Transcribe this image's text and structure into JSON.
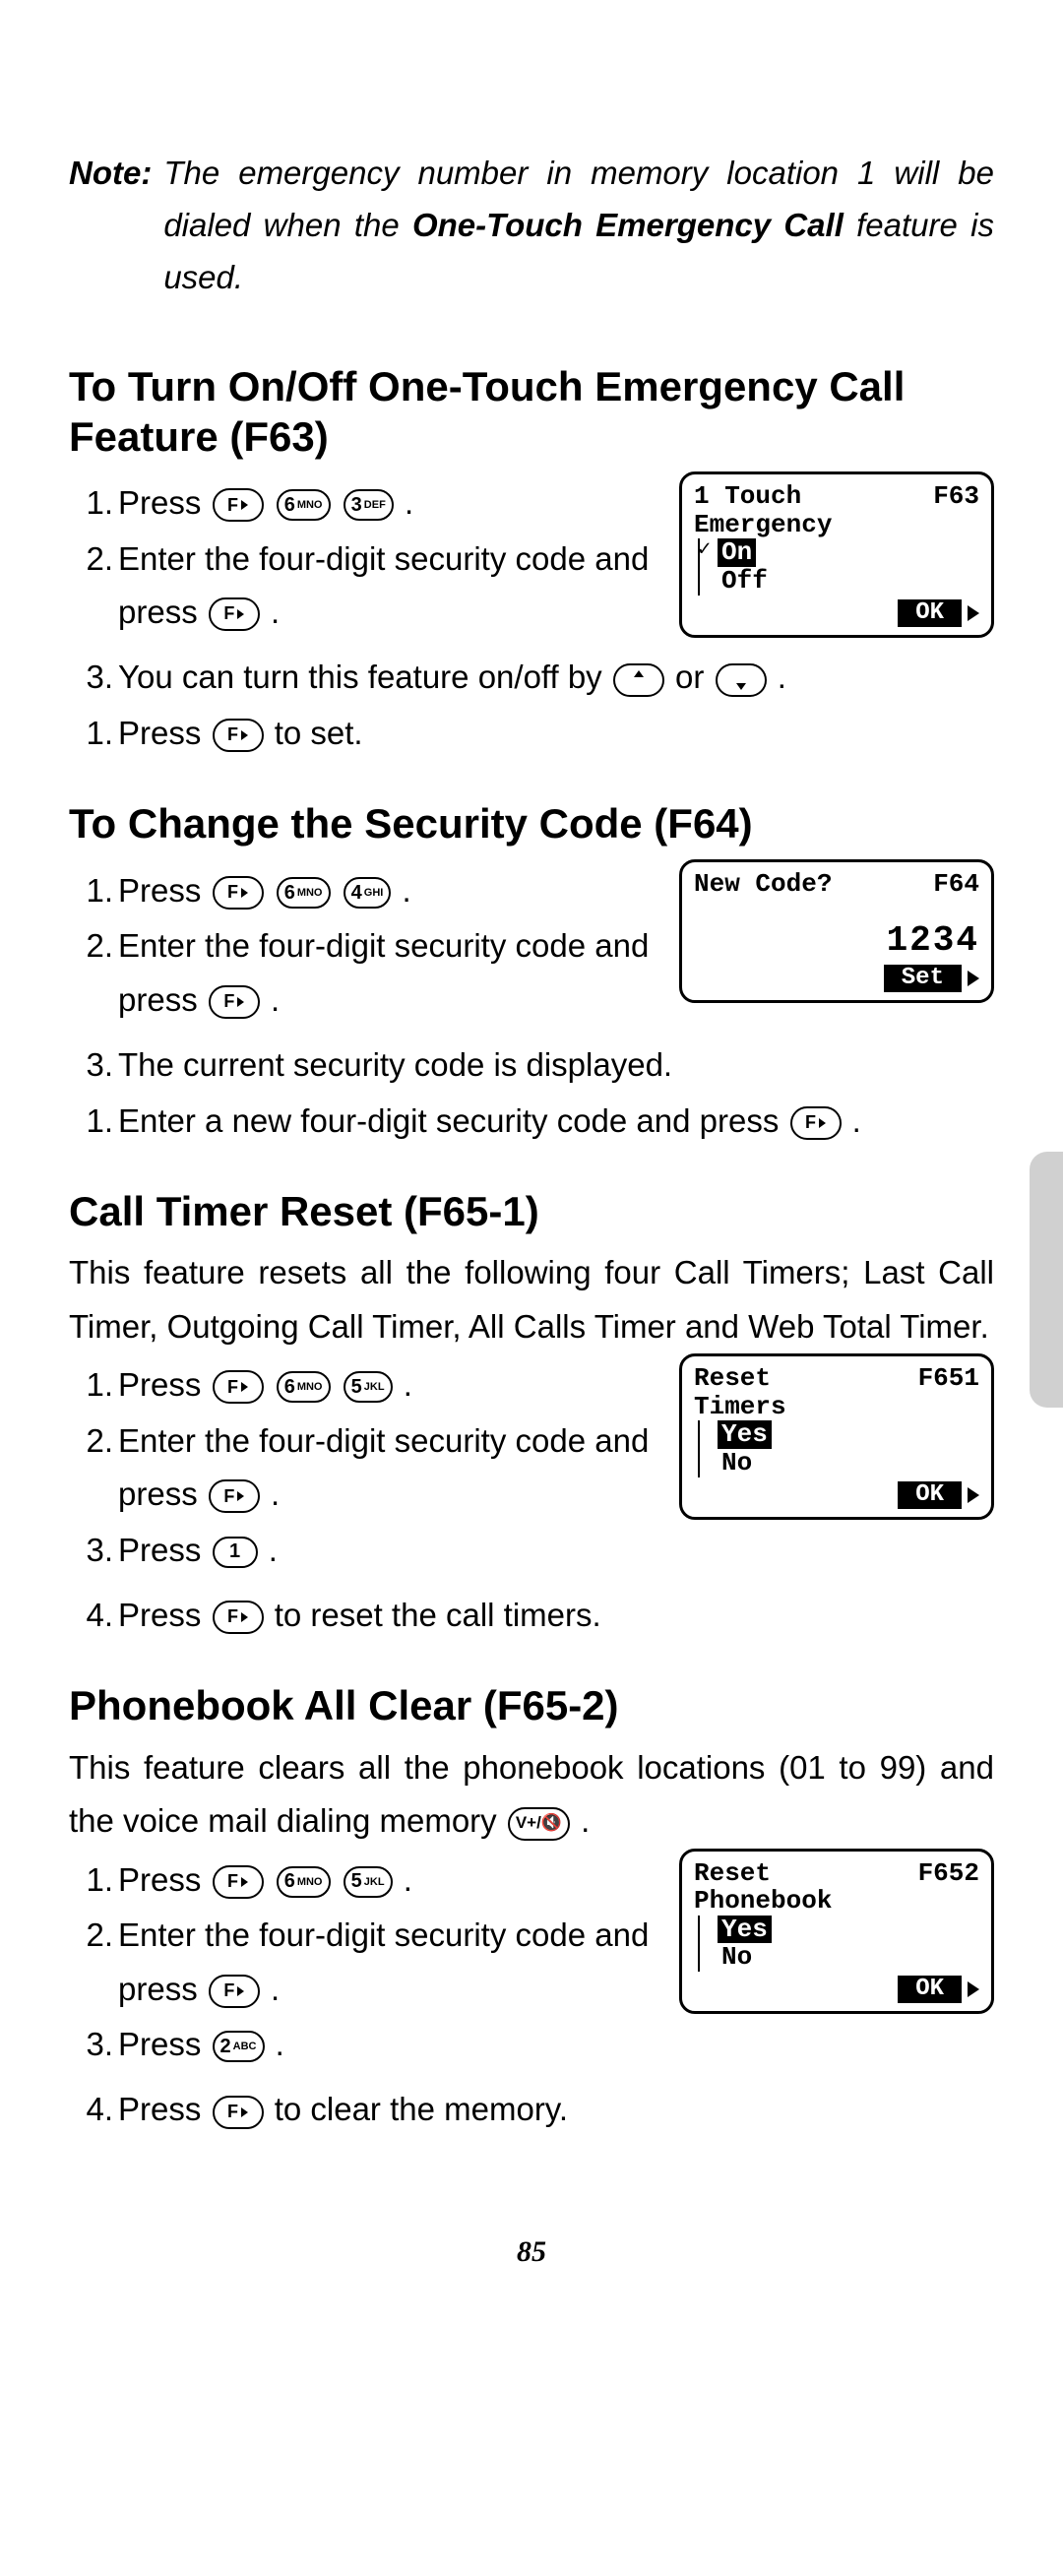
{
  "note": {
    "label": "Note:",
    "text_before": "The emergency number in memory location 1 will be dialed when the ",
    "bold": "One-Touch Emergency Call",
    "text_after": " feature is used."
  },
  "sections": {
    "f63": {
      "heading": "To Turn On/Off One-Touch Emergency Call Feature (F63)",
      "step1": "Press ",
      "step2a": "Enter the four-digit security code and press ",
      "step3a": "You can turn this feature on/off by ",
      "step3b": " or ",
      "step4a": "Press ",
      "step4b": " to set.",
      "screen": {
        "line1_left": "1 Touch",
        "line1_right": "F63",
        "line2": "Emergency",
        "opt_on": "On",
        "opt_off": "Off",
        "ok": "OK"
      }
    },
    "f64": {
      "heading": "To Change the Security Code (F64)",
      "step1": "Press ",
      "step2a": "Enter the four-digit security code and press ",
      "step3": "The current security code is displayed.",
      "step4a": "Enter a new four-digit security code and press ",
      "screen": {
        "line1_left": "New Code?",
        "line1_right": "F64",
        "value": "1234",
        "set": "Set"
      }
    },
    "f651": {
      "heading": "Call Timer Reset (F65-1)",
      "intro": "This feature resets all the following four Call Timers; Last Call Timer, Outgoing Call Timer, All Calls Timer and Web Total Timer.",
      "step1": "Press ",
      "step2a": "Enter the four-digit security code and press ",
      "step3": "Press ",
      "step4a": "Press ",
      "step4b": " to reset the call timers.",
      "screen": {
        "line1_left": "Reset",
        "line1_right": "F651",
        "line2": "Timers",
        "yes": "Yes",
        "no": "No",
        "ok": "OK"
      }
    },
    "f652": {
      "heading": "Phonebook All Clear (F65-2)",
      "intro_a": "This feature clears all the phonebook locations (01 to 99) and the voice mail dialing memory ",
      "step1": "Press ",
      "step2a": "Enter the four-digit security code and press ",
      "step3": "Press ",
      "step4a": "Press ",
      "step4b": " to clear the memory.",
      "screen": {
        "line1_left": "Reset",
        "line1_right": "F652",
        "line2": "Phonebook",
        "yes": "Yes",
        "no": "No",
        "ok": "OK"
      }
    }
  },
  "keys": {
    "six": "6",
    "six_sub": "MNO",
    "three": "3",
    "three_sub": "DEF",
    "four": "4",
    "four_sub": "GHI",
    "five": "5",
    "five_sub": "JKL",
    "one": "1",
    "two": "2",
    "two_sub": "ABC",
    "vplus": "V+/"
  },
  "page_number": "85"
}
